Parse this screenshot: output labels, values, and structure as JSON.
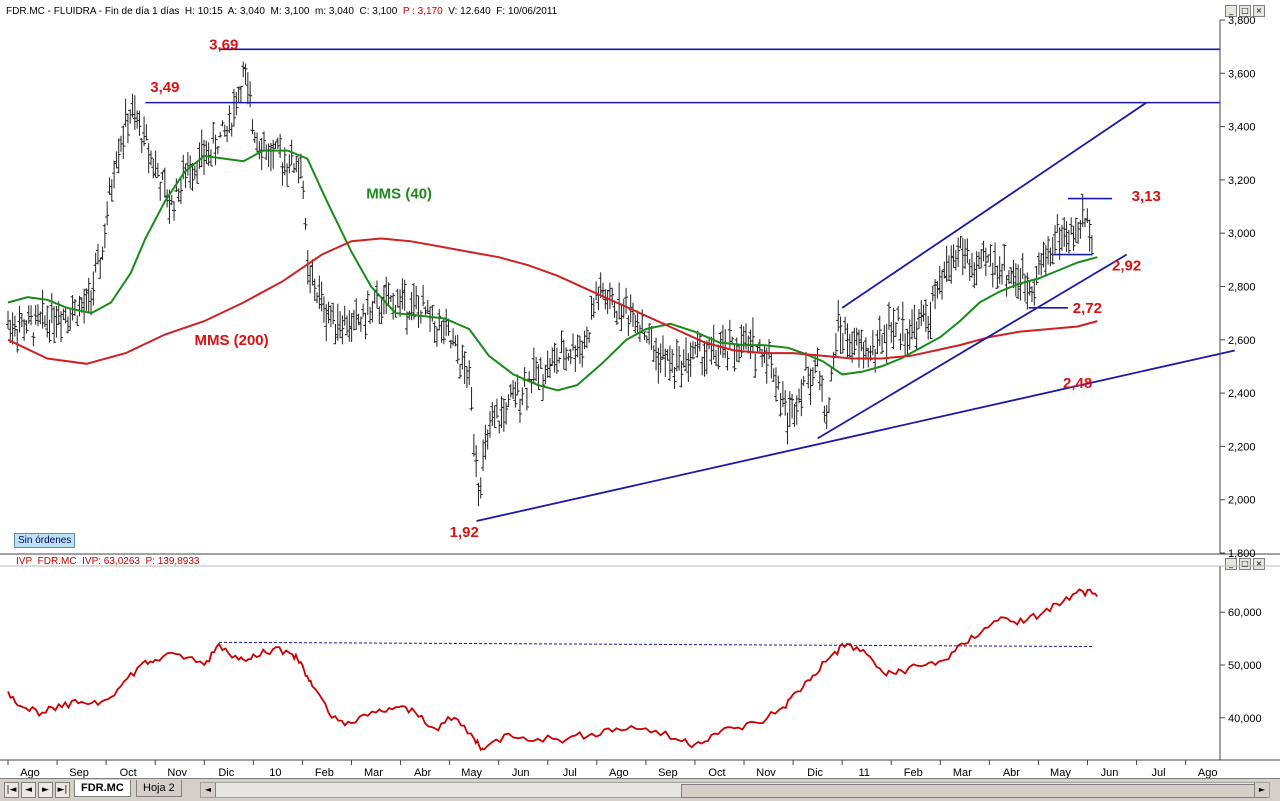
{
  "window": {
    "header_parts": [
      {
        "text": "FDR.MC - FLUIDRA - Fin de día 1 días  H: 10:15  A: 3,040  M: 3,100  m: 3,040  C: 3,100  ",
        "color": "black"
      },
      {
        "text": "P : 3,170",
        "color": "red"
      },
      {
        "text": "  V: 12.640  F: 10/06/2011",
        "color": "black"
      }
    ],
    "sub_header_parts": [
      {
        "text": "IVP_FDR.MC  IVP: 63,0263  ",
        "color": "red"
      },
      {
        "text": "P: 139,8933",
        "color": "red"
      }
    ],
    "status_badge": "Sin órdenes",
    "tabs": [
      {
        "label": "FDR.MC",
        "active": true
      },
      {
        "label": "Hoja 2",
        "active": false
      }
    ],
    "nav_buttons": [
      "|◄",
      "◄",
      "►",
      "►|"
    ]
  },
  "colors": {
    "bars": "#222222",
    "mms40": "#1a8a1a",
    "mms200": "#cc2222",
    "trendlines": "#1a1aa8",
    "annotation": "#dd1111",
    "ivp": "#cc0000",
    "ivp_dashed": "#1a1aa8"
  },
  "chart_data": [
    {
      "type": "line",
      "subtype": "ohlc-bars",
      "title": "FDR.MC - FLUIDRA",
      "ylim": [
        1.8,
        3.8
      ],
      "yticks": [
        "1,800",
        "2,000",
        "2,200",
        "2,400",
        "2,600",
        "2,800",
        "3,000",
        "3,200",
        "3,400",
        "3,600",
        "3,800"
      ],
      "ytick_values": [
        1.8,
        2.0,
        2.2,
        2.4,
        2.6,
        2.8,
        3.0,
        3.2,
        3.4,
        3.6,
        3.8
      ],
      "x_months": [
        "Ago",
        "Sep",
        "Oct",
        "Nov",
        "Dic",
        "10",
        "Feb",
        "Mar",
        "Abr",
        "May",
        "Jun",
        "Jul",
        "Ago",
        "Sep",
        "Oct",
        "Nov",
        "Dic",
        "11",
        "Feb",
        "Mar",
        "Abr",
        "May",
        "Jun",
        "Jul",
        "Ago"
      ],
      "x_range_months": [
        0,
        24.7
      ],
      "price_path": [
        [
          0,
          2.66
        ],
        [
          0.5,
          2.65
        ],
        [
          1,
          2.7
        ],
        [
          1.6,
          2.72
        ],
        [
          1.9,
          2.9
        ],
        [
          2.2,
          3.3
        ],
        [
          2.5,
          3.45
        ],
        [
          2.8,
          3.35
        ],
        [
          3.1,
          3.2
        ],
        [
          3.3,
          3.1
        ],
        [
          3.7,
          3.25
        ],
        [
          4.1,
          3.3
        ],
        [
          4.5,
          3.4
        ],
        [
          4.8,
          3.6
        ],
        [
          5.0,
          3.4
        ],
        [
          5.3,
          3.3
        ],
        [
          5.6,
          3.28
        ],
        [
          6.0,
          3.25
        ],
        [
          6.1,
          2.85
        ],
        [
          6.5,
          2.7
        ],
        [
          7.0,
          2.65
        ],
        [
          7.5,
          2.72
        ],
        [
          8.0,
          2.75
        ],
        [
          8.5,
          2.7
        ],
        [
          9.0,
          2.6
        ],
        [
          9.4,
          2.45
        ],
        [
          9.6,
          2.05
        ],
        [
          9.8,
          2.25
        ],
        [
          10.2,
          2.35
        ],
        [
          10.6,
          2.45
        ],
        [
          11.0,
          2.5
        ],
        [
          11.4,
          2.55
        ],
        [
          11.8,
          2.6
        ],
        [
          12.0,
          2.78
        ],
        [
          12.4,
          2.72
        ],
        [
          12.8,
          2.7
        ],
        [
          13.2,
          2.55
        ],
        [
          13.6,
          2.5
        ],
        [
          14.0,
          2.55
        ],
        [
          14.5,
          2.55
        ],
        [
          15.0,
          2.58
        ],
        [
          15.5,
          2.55
        ],
        [
          15.9,
          2.3
        ],
        [
          16.2,
          2.45
        ],
        [
          16.5,
          2.5
        ],
        [
          16.7,
          2.3
        ],
        [
          16.9,
          2.65
        ],
        [
          17.2,
          2.58
        ],
        [
          17.6,
          2.55
        ],
        [
          18.0,
          2.65
        ],
        [
          18.4,
          2.63
        ],
        [
          18.8,
          2.7
        ],
        [
          19.1,
          2.85
        ],
        [
          19.4,
          2.95
        ],
        [
          19.7,
          2.85
        ],
        [
          20.0,
          2.9
        ],
        [
          20.4,
          2.85
        ],
        [
          20.8,
          2.8
        ],
        [
          21.1,
          2.9
        ],
        [
          21.4,
          3.0
        ],
        [
          21.7,
          2.98
        ],
        [
          21.9,
          3.05
        ],
        [
          22.1,
          3.02
        ]
      ],
      "series": [
        {
          "name": "MMS (40)",
          "x_months": [
            0,
            0.4,
            0.8,
            1.2,
            1.7,
            2.1,
            2.5,
            2.8,
            3.2,
            3.6,
            4.0,
            4.4,
            4.8,
            5.2,
            5.7,
            6.1,
            6.5,
            7.0,
            7.4,
            7.9,
            8.4,
            8.9,
            9.4,
            9.8,
            10.3,
            10.8,
            11.2,
            11.6,
            12.1,
            12.6,
            13.0,
            13.5,
            14.0,
            14.5,
            15.0,
            15.4,
            15.9,
            16.2,
            16.6,
            17.0,
            17.4,
            17.8,
            18.2,
            18.6,
            19.0,
            19.4,
            19.8,
            20.2,
            20.6,
            21.0,
            21.4,
            21.8,
            22.2
          ],
          "values": [
            2.74,
            2.76,
            2.75,
            2.72,
            2.7,
            2.74,
            2.85,
            2.98,
            3.12,
            3.23,
            3.29,
            3.28,
            3.27,
            3.31,
            3.31,
            3.28,
            3.12,
            2.93,
            2.8,
            2.7,
            2.69,
            2.68,
            2.64,
            2.54,
            2.47,
            2.43,
            2.41,
            2.43,
            2.51,
            2.6,
            2.64,
            2.66,
            2.63,
            2.59,
            2.58,
            2.58,
            2.57,
            2.55,
            2.52,
            2.47,
            2.48,
            2.5,
            2.53,
            2.57,
            2.61,
            2.67,
            2.74,
            2.78,
            2.81,
            2.83,
            2.86,
            2.89,
            2.91
          ]
        },
        {
          "name": "MMS (200)",
          "x_months": [
            0,
            0.8,
            1.6,
            2.4,
            3.2,
            4.0,
            4.8,
            5.6,
            6.4,
            7.0,
            7.6,
            8.2,
            8.8,
            9.4,
            10.0,
            10.6,
            11.2,
            11.8,
            12.4,
            13.0,
            13.6,
            14.2,
            14.8,
            15.4,
            16.0,
            16.6,
            17.2,
            17.8,
            18.4,
            18.9,
            19.4,
            20.0,
            20.6,
            21.2,
            21.8,
            22.2
          ],
          "values": [
            2.6,
            2.53,
            2.51,
            2.55,
            2.62,
            2.67,
            2.74,
            2.82,
            2.92,
            2.97,
            2.98,
            2.97,
            2.95,
            2.93,
            2.91,
            2.88,
            2.84,
            2.79,
            2.74,
            2.69,
            2.64,
            2.59,
            2.56,
            2.55,
            2.55,
            2.54,
            2.53,
            2.53,
            2.54,
            2.56,
            2.58,
            2.61,
            2.63,
            2.64,
            2.65,
            2.67
          ]
        }
      ],
      "hlines": [
        {
          "label": "3,69",
          "y": 3.69,
          "x_from": 4.3,
          "x_to": 24.7
        },
        {
          "label": "3,49",
          "y": 3.49,
          "x_from": 2.8,
          "x_to": 24.7
        },
        {
          "label": "3,13",
          "y": 3.13,
          "x_from": 21.6,
          "x_to": 22.5
        },
        {
          "label": "2,92",
          "y": 2.92,
          "x_from": 21.3,
          "x_to": 22.1
        },
        {
          "label": "2,72",
          "y": 2.72,
          "x_from": 20.8,
          "x_to": 21.6
        }
      ],
      "trendlines": [
        {
          "x1": 9.55,
          "y1": 1.92,
          "x2": 25.0,
          "y2": 2.56
        },
        {
          "x1": 16.5,
          "y1": 2.23,
          "x2": 22.8,
          "y2": 2.92
        },
        {
          "x1": 17.0,
          "y1": 2.72,
          "x2": 23.2,
          "y2": 3.49
        }
      ],
      "annotations": [
        {
          "text": "3,69",
          "x": 4.1,
          "y": 3.69
        },
        {
          "text": "3,49",
          "x": 2.9,
          "y": 3.53
        },
        {
          "text": "MMS (40)",
          "x": 7.3,
          "y": 3.13,
          "color": "green"
        },
        {
          "text": "MMS (200)",
          "x": 3.8,
          "y": 2.58
        },
        {
          "text": "1,92",
          "x": 9.0,
          "y": 1.86
        },
        {
          "text": "3,13",
          "x": 22.9,
          "y": 3.12
        },
        {
          "text": "2,92",
          "x": 22.5,
          "y": 2.86
        },
        {
          "text": "2,72",
          "x": 21.7,
          "y": 2.7
        },
        {
          "text": "2,48",
          "x": 21.5,
          "y": 2.42
        }
      ]
    },
    {
      "type": "line",
      "title": "IVP_FDR.MC",
      "ylim": [
        32,
        68
      ],
      "yticks": [
        "40,000",
        "50,000",
        "60,000"
      ],
      "ytick_values": [
        40,
        50,
        60
      ],
      "series": [
        {
          "name": "IVP",
          "x_months": [
            0,
            0.3,
            0.7,
            1.1,
            1.5,
            1.9,
            2.3,
            2.7,
            3.0,
            3.5,
            4.0,
            4.3,
            4.7,
            5.0,
            5.4,
            5.8,
            6.0,
            6.2,
            6.6,
            7.0,
            7.5,
            7.9,
            8.3,
            8.7,
            9.1,
            9.5,
            9.7,
            10.2,
            10.8,
            11.4,
            11.9,
            12.4,
            13.0,
            13.6,
            14.0,
            14.4,
            14.8,
            15.3,
            15.8,
            16.1,
            16.4,
            16.8,
            17.1,
            17.5,
            17.9,
            18.2,
            18.7,
            19.1,
            19.5,
            19.9,
            20.3,
            20.7,
            21.1,
            21.5,
            21.9,
            22.2
          ],
          "values": [
            45,
            42,
            41,
            42,
            43,
            43,
            46,
            50,
            51,
            52,
            50,
            54,
            51,
            52,
            53,
            52,
            50,
            46,
            40,
            39,
            41,
            42,
            41,
            38,
            40,
            36,
            34,
            37,
            36,
            36,
            37,
            38,
            38,
            36,
            35,
            37,
            38,
            39,
            42,
            45,
            48,
            52,
            54,
            52,
            48,
            49,
            50,
            51,
            54,
            57,
            59,
            58,
            60,
            62,
            64,
            63
          ]
        },
        {
          "name": "IVP ref",
          "x_months": [
            4.3,
            22.1
          ],
          "values": [
            54.3,
            53.5
          ]
        }
      ]
    }
  ]
}
